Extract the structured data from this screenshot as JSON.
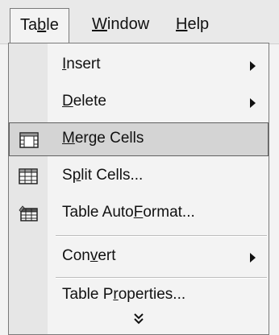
{
  "menubar": {
    "items": [
      {
        "label_pre": "Ta",
        "label_u": "b",
        "label_post": "le"
      },
      {
        "label_pre": "",
        "label_u": "W",
        "label_post": "indow"
      },
      {
        "label_pre": "",
        "label_u": "H",
        "label_post": "elp"
      }
    ]
  },
  "menu": {
    "items": [
      {
        "pre": "",
        "u": "I",
        "post": "nsert",
        "icon": "",
        "submenu": true
      },
      {
        "pre": "",
        "u": "D",
        "post": "elete",
        "icon": "",
        "submenu": true
      },
      {
        "pre": "",
        "u": "M",
        "post": "erge Cells",
        "icon": "merge-cells-icon",
        "submenu": false
      },
      {
        "pre": "S",
        "u": "p",
        "post": "lit Cells...",
        "icon": "split-cells-icon",
        "submenu": false
      },
      {
        "pre": "Table Auto",
        "u": "F",
        "post": "ormat...",
        "icon": "table-autoformat-icon",
        "submenu": false
      },
      {
        "pre": "Con",
        "u": "v",
        "post": "ert",
        "icon": "",
        "submenu": true
      },
      {
        "pre": "Table P",
        "u": "r",
        "post": "operties...",
        "icon": "",
        "submenu": false
      }
    ],
    "expand_glyph": "⌄⌄"
  }
}
